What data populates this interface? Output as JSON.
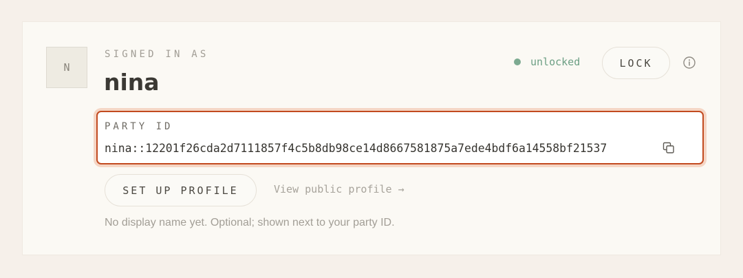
{
  "account": {
    "avatar_initial": "N",
    "signed_in_label": "SIGNED IN AS",
    "username": "nina",
    "status": {
      "text": "unlocked",
      "color": "#7daa91"
    },
    "lock_label": "LOCK",
    "info_icon": "info-circle-icon"
  },
  "party": {
    "label": "PARTY ID",
    "value": "nina::12201f26cda2d7111857f4c5b8db98ce14d8667581875a7ede4bdf6a14558bf21537",
    "copy_icon": "copy-icon",
    "highlight_color": "#c24a1f"
  },
  "profile": {
    "setup_label": "SET UP PROFILE",
    "public_link": "View public profile →",
    "hint": "No display name yet. Optional; shown next to your party ID."
  }
}
